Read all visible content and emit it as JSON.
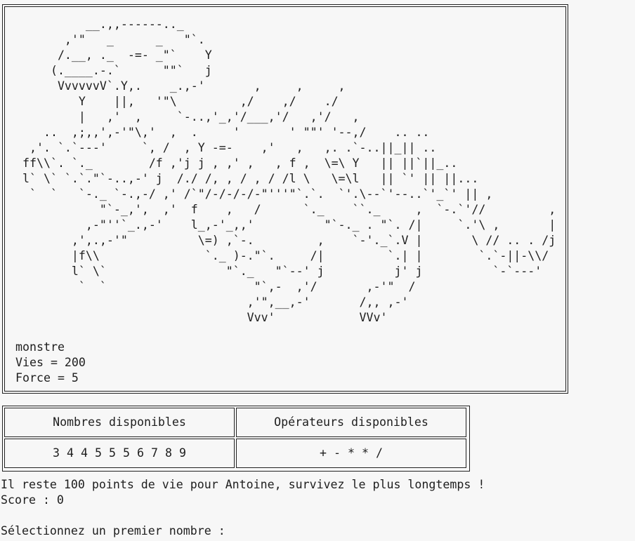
{
  "monster": {
    "ascii_art": "          __.,,------.._\n       ,'\"   _      _   \"`.\n      /.__, ._  -=- _\"`    Y\n     (.____.-.`      \"\"`   j\n      VvvvvvV`.Y,.    _.,-'       ,     ,     ,\n         Y    ||,   '\"\\         ,/    ,/    ./\n         |   ,'  ,     `-..,'_,'/___,'/   ,'/   ,\n    ..  ,;,,',-'\"\\,'  ,  .     '       ' \"\"' '--,/    .. ..\n  ,'. `.`---'     `, /  , Y -=-    ,'   ,   ,. .`-..||_|| ..\n ff\\\\`. `._        /f ,'j j , ,' ,   , f ,  \\=\\ Y   || ||`||_..\n l` \\` `.`.\"`-..,-' j  /./ /, , / , / /l \\   \\=\\l   || `' || ||...\n  `  `   `-._ `-.,-/ ,' /`\"/-/-/-/-\"'''\"`.`.  `'.\\--`'--..`'_`' || ,\n            \"`-_,',  ,'  f    ,   /      `._    ``._     ,  `-.`'//         ,\n          ,-\"''`_.,-'    l_,-'_,,'          \"`-._ . \"`. /|     `.'\\ ,       |\n        ,',.,-'\"          \\=) ,`-.         ,    `-'._`.V |       \\ // .. . /j\n        |f\\\\               `._ )-.\"`.     /|         `.| |        `.`-||-\\\\/\n        l` \\`                 \"`._   \"`--' j          j' j          `-`---'\n         `  `                     \"`,-  ,'/       ,-'\"  /\n                                 ,'\",__,-'       /,, ,-'\n                                 Vvv'            VVv'",
    "name": "monstre",
    "lives_text": "Vies = 200",
    "force_text": "Force = 5"
  },
  "choices": {
    "numbers_header": "Nombres disponibles",
    "operators_header": "Opérateurs disponibles",
    "numbers": [
      "3",
      "4",
      "4",
      "5",
      "5",
      "5",
      "6",
      "7",
      "8",
      "9"
    ],
    "operators": [
      "+",
      "-",
      "*",
      "*",
      "/"
    ]
  },
  "messages": {
    "status": "Il reste 100 points de vie pour Antoine, survivez le plus longtemps !",
    "score": "Score : 0",
    "prompt": "Sélectionnez un premier nombre :"
  }
}
